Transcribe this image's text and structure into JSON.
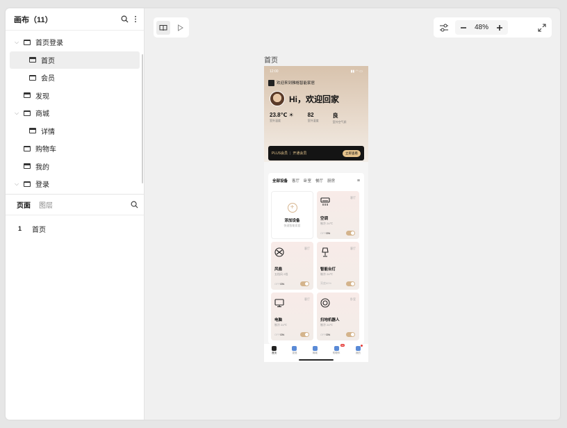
{
  "sidebar": {
    "title": "画布（11）",
    "tree": [
      {
        "label": "首页登录",
        "level": 0,
        "expandable": true,
        "selected": false
      },
      {
        "label": "首页",
        "level": 1,
        "expandable": false,
        "selected": true
      },
      {
        "label": "会员",
        "level": 1,
        "expandable": false,
        "selected": false
      },
      {
        "label": "发现",
        "level": 0,
        "expandable": false,
        "selected": false
      },
      {
        "label": "商城",
        "level": 0,
        "expandable": true,
        "selected": false
      },
      {
        "label": "详情",
        "level": 1,
        "expandable": false,
        "selected": false
      },
      {
        "label": "购物车",
        "level": 0,
        "expandable": false,
        "selected": false
      },
      {
        "label": "我的",
        "level": 0,
        "expandable": false,
        "selected": false
      },
      {
        "label": "登录",
        "level": 0,
        "expandable": true,
        "selected": false
      }
    ],
    "tabs": {
      "pages": "页面",
      "layers": "图层"
    },
    "page_list": [
      {
        "num": "1",
        "label": "首页"
      }
    ]
  },
  "toolbar": {
    "zoom": "48%"
  },
  "phone": {
    "frame_label": "首页",
    "status_time": "12:00",
    "welcome": "欢迎来到雅格智能家居",
    "greeting": "Hi，欢迎回家",
    "stats": [
      {
        "value": "23.8℃ ☀",
        "label": "室外温度"
      },
      {
        "value": "82",
        "label": "室外湿度"
      },
      {
        "value": "良",
        "label": "室外空气质"
      }
    ],
    "plus": {
      "title": "PLUS会员",
      "sub": "开通会员",
      "button": "立即查看"
    },
    "device_tabs": [
      "全部设备",
      "客厅",
      "卧室",
      "餐厅",
      "厨房"
    ],
    "add_card": {
      "name": "添加设备",
      "status": "快速智能家居"
    },
    "devices": [
      {
        "name": "空调",
        "status": "制冷 24℃",
        "room": "客厅",
        "off": "OFF",
        "on": "ON"
      },
      {
        "name": "风扇",
        "status": "五档风 2档",
        "room": "客厅",
        "off": "OFF",
        "on": "ON"
      },
      {
        "name": "智能台灯",
        "status": "制冷 24℃",
        "room": "客厅",
        "off": "亮度80%",
        "on": ""
      },
      {
        "name": "电脑",
        "status": "制冷 24℃",
        "room": "客厅",
        "off": "OFF",
        "on": "ON"
      },
      {
        "name": "扫地机器人",
        "status": "制冷 24℃",
        "room": "卧室",
        "off": "OFF",
        "on": "ON"
      }
    ],
    "tabbar": [
      {
        "label": "首页"
      },
      {
        "label": "发现"
      },
      {
        "label": "商城"
      },
      {
        "label": "购物车",
        "badge": "99"
      },
      {
        "label": "我的"
      }
    ]
  }
}
